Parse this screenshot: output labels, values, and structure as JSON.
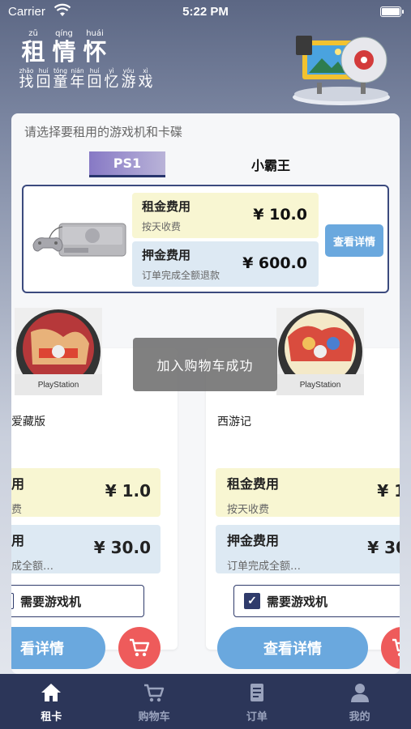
{
  "status_bar": {
    "carrier": "Carrier",
    "time": "5:22 PM"
  },
  "header": {
    "title": [
      {
        "py": "zū",
        "hz": "租"
      },
      {
        "py": "qíng",
        "hz": "情"
      },
      {
        "py": "huái",
        "hz": "怀"
      }
    ],
    "subtitle": [
      {
        "py": "zhǎo",
        "hz": "找"
      },
      {
        "py": "huí",
        "hz": "回"
      },
      {
        "py": "tóng",
        "hz": "童"
      },
      {
        "py": "nián",
        "hz": "年"
      },
      {
        "py": "huí",
        "hz": "回"
      },
      {
        "py": "yì",
        "hz": "忆"
      },
      {
        "py": "yóu",
        "hz": "游"
      },
      {
        "py": "xì",
        "hz": "戏"
      }
    ]
  },
  "main": {
    "prompt": "请选择要租用的游戏机和卡碟",
    "tabs": [
      {
        "label": "PS1",
        "active": true
      },
      {
        "label": "小霸王",
        "active": false
      }
    ],
    "console": {
      "rent_title": "租金费用",
      "rent_sub": "按天收费",
      "rent_value": "¥ 10.0",
      "deposit_title": "押金费用",
      "deposit_sub": "订单完成全额退款",
      "deposit_value": "¥ 600.0",
      "detail_label": "查看详情"
    },
    "games": [
      {
        "disc_label": "PlayStation",
        "name": "爱藏版",
        "rent_title": "用",
        "rent_sub": "费",
        "rent_value": "¥ 1.0",
        "deposit_title": "用",
        "deposit_sub": "成全额…",
        "deposit_value": "¥ 30.0",
        "need_console": "需要游戏机",
        "need_checked": false,
        "detail_label": "看详情"
      },
      {
        "disc_label": "PlayStation",
        "name": "西游记",
        "rent_title": "租金费用",
        "rent_sub": "按天收费",
        "rent_value": "¥ 1",
        "deposit_title": "押金费用",
        "deposit_sub": "订单完成全额…",
        "deposit_value": "¥ 30",
        "need_console": "需要游戏机",
        "need_checked": true,
        "detail_label": "查看详情"
      }
    ],
    "toast": "加入购物车成功"
  },
  "tabbar": [
    {
      "label": "租卡",
      "icon": "home-icon",
      "active": true
    },
    {
      "label": "购物车",
      "icon": "cart-icon",
      "active": false
    },
    {
      "label": "订单",
      "icon": "order-icon",
      "active": false
    },
    {
      "label": "我的",
      "icon": "profile-icon",
      "active": false
    }
  ],
  "colors": {
    "accent": "#6aa8de",
    "navy": "#2c3659",
    "cart": "#ee5b5b",
    "rent_bg": "#f8f6d2",
    "deposit_bg": "#dde9f3"
  }
}
